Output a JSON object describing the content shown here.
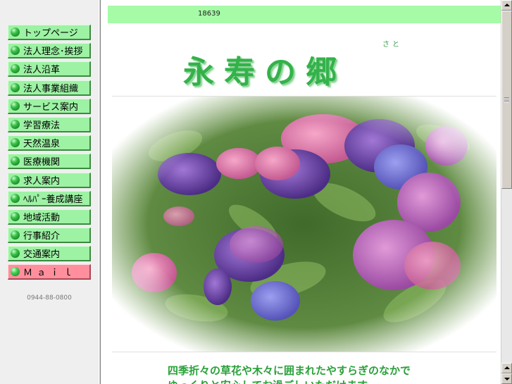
{
  "nav": {
    "items": [
      {
        "label": "トップページ",
        "icon": "green-ball-icon"
      },
      {
        "label": "法人理念･挨拶",
        "icon": "green-ball-icon"
      },
      {
        "label": "法人沿革",
        "icon": "green-ball-icon"
      },
      {
        "label": "法人事業組織",
        "icon": "green-ball-icon"
      },
      {
        "label": "サービス案内",
        "icon": "green-ball-icon"
      },
      {
        "label": "学習療法",
        "icon": "green-ball-icon"
      },
      {
        "label": "天然温泉",
        "icon": "green-ball-icon"
      },
      {
        "label": "医療機関",
        "icon": "green-ball-icon"
      },
      {
        "label": "求人案内",
        "icon": "green-ball-icon"
      },
      {
        "label": "ﾍﾙﾊﾟｰ養成講座",
        "icon": "green-ball-icon"
      },
      {
        "label": "地域活動",
        "icon": "green-ball-icon"
      },
      {
        "label": "行事紹介",
        "icon": "green-ball-icon"
      },
      {
        "label": "交通案内",
        "icon": "green-ball-icon"
      }
    ],
    "mail_label": "Ｍａｉｌ",
    "phone": "0944-88-0800"
  },
  "main": {
    "counter": "18639",
    "logo": "永寿の郷",
    "logo_ruby": "さと",
    "photo_alt": "hydrangea-flowers-photo",
    "caption_line1": "四季折々の草花や木々に囲まれたやすらぎのなかで",
    "caption_line2": "ゆっくりと安心してお過ごしいただけます"
  },
  "colors": {
    "counter_bar": "#a6fba6",
    "nav_button": "#9df2a4",
    "mail_button": "#ff8f9d",
    "logo_green": "#33b24a",
    "caption_green": "#2aa13a"
  }
}
